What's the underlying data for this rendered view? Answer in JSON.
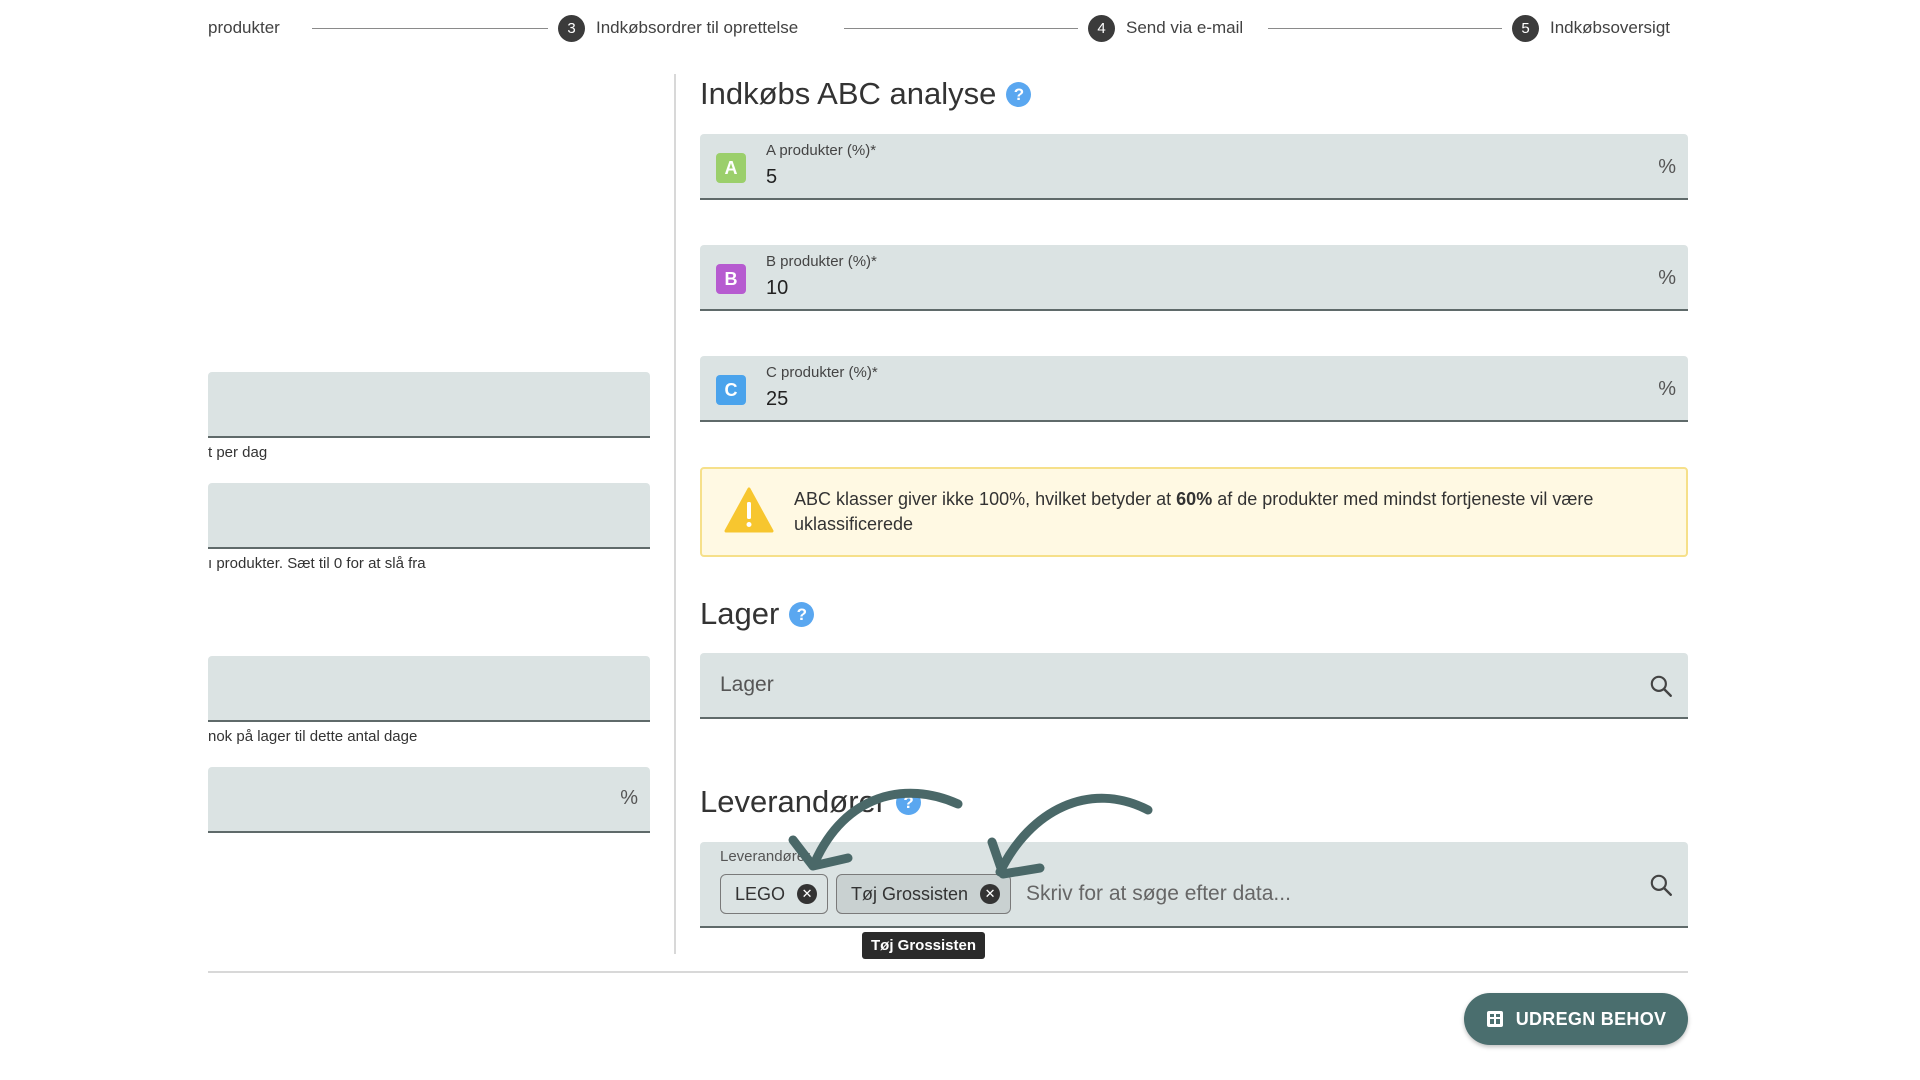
{
  "stepper": {
    "steps": [
      {
        "number": "",
        "label": "produkter"
      },
      {
        "number": "3",
        "label": "Indkøbsordrer til oprettelse"
      },
      {
        "number": "4",
        "label": "Send via e-mail"
      },
      {
        "number": "5",
        "label": "Indkøbsoversigt"
      }
    ]
  },
  "left": {
    "hints": [
      "t per dag",
      "ı produkter. Sæt til 0 for at slå fra",
      "nok på lager til dette antal dage"
    ],
    "pct_suffix": "%"
  },
  "abc": {
    "title": "Indkøbs ABC analyse",
    "help_icon": "question-circle-icon",
    "fields": [
      {
        "badge": "A",
        "label": "A produkter (%)*",
        "value": "5",
        "suffix": "%",
        "color": "#9bcf6b"
      },
      {
        "badge": "B",
        "label": "B produkter (%)*",
        "value": "10",
        "suffix": "%",
        "color": "#b65bd0"
      },
      {
        "badge": "C",
        "label": "C produkter (%)*",
        "value": "25",
        "suffix": "%",
        "color": "#4aa3ec"
      }
    ],
    "warning": {
      "before": "ABC klasser giver ikke 100%, hvilket betyder at ",
      "bold": "60%",
      "after": " af de produkter med mindst fortjeneste vil være uklassificerede"
    }
  },
  "lager": {
    "title": "Lager",
    "placeholder": "Lager"
  },
  "leverandorer": {
    "title": "Leverandører",
    "label": "Leverandører",
    "chips": [
      "LEGO",
      "Tøj Grossisten"
    ],
    "placeholder": "Skriv for at søge efter data...",
    "tooltip": "Tøj Grossisten"
  },
  "actions": {
    "calculate_label": "UDREGN BEHOV"
  },
  "colors": {
    "field_bg": "#dbe3e3",
    "accent": "#4a6e6e",
    "help": "#5aa7f0",
    "warning_bg": "#fff9e3",
    "warning_border": "#f6e08a",
    "arrow": "#4a6868"
  }
}
